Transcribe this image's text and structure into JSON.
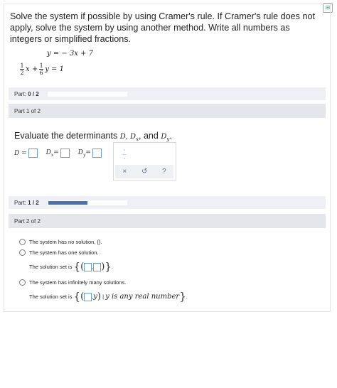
{
  "instructions": "Solve the system if possible by using Cramer's rule. If Cramer's rule does not apply, solve the system by using another method. Write all numbers as integers or simplified fractions.",
  "equations": {
    "eq1": "y = − 3x + 7",
    "eq2": {
      "frac1_num": "1",
      "frac1_den": "2",
      "var1": "x +",
      "frac2_num": "1",
      "frac2_den": "6",
      "var2": "y = 1"
    }
  },
  "part_progress_1": {
    "label_prefix": "Part:",
    "value": "0 / 2",
    "fraction": 0
  },
  "part1_header": "Part 1 of 2",
  "evaluate_text": "Evaluate the determinants",
  "evaluate_vars": {
    "d": "D,",
    "dx": "D",
    "dx_sub": "x",
    "dy_sep": ", and",
    "dy": "D",
    "dy_sub": "y",
    "end": "."
  },
  "det_labels": {
    "d": "D =",
    "dx": "D",
    "dx_sub": "x",
    "dx_eq": "=",
    "dy": "D",
    "dy_sub": "y",
    "dy_eq": "="
  },
  "tools": {
    "clear": "×",
    "undo": "↺",
    "help": "?"
  },
  "part_progress_2": {
    "label_prefix": "Part:",
    "value": "1 / 2",
    "fraction": 0.5
  },
  "part2_header": "Part 2 of 2",
  "options": {
    "no_solution": "The system has no solution,",
    "no_solution_set": "{}.",
    "one_solution": "The system has one solution.",
    "solution_set_is": "The solution set is",
    "infinite": "The system has infinitely many solutions.",
    "solution_set_is_2": "The solution set is",
    "any_real": "y is any real number",
    "period": "."
  },
  "colors": {
    "accent": "#4a6fb3",
    "input_border": "#6aa0c8",
    "header_bg": "#e4e6ec"
  }
}
